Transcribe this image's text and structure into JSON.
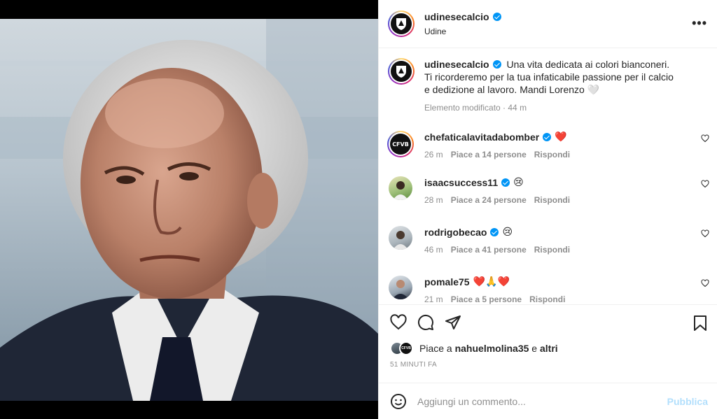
{
  "post": {
    "username": "udinesecalcio",
    "location": "Udine",
    "more_icon": "more-options-icon",
    "caption": "Una vita dedicata ai colori bianconeri. Ti ricorderemo per la tua infaticabile passione per il calcio e dedizione al lavoro. Mandi Lorenzo 🤍",
    "caption_meta": "Elemento modificato · 44 m"
  },
  "comments": [
    {
      "username": "chefaticalavitadabomber",
      "text": "❤️",
      "time": "26 m",
      "likes": "Piace a 14 persone",
      "reply": "Rispondi"
    },
    {
      "username": "isaacsuccess11",
      "text": "😢",
      "time": "28 m",
      "likes": "Piace a 24 persone",
      "reply": "Rispondi"
    },
    {
      "username": "rodrigobecao",
      "text": "😢",
      "time": "46 m",
      "likes": "Piace a 41 persone",
      "reply": "Rispondi"
    },
    {
      "username": "pomale75",
      "text": "❤️🙏❤️",
      "time": "21 m",
      "likes": "Piace a 5 persone",
      "reply": "Rispondi"
    }
  ],
  "likes": {
    "prefix": "Piace a",
    "user": "nahuelmolina35",
    "joiner": "e",
    "others": "altri"
  },
  "timestamp": "51 MINUTI FA",
  "composer": {
    "placeholder": "Aggiungi un commento...",
    "publish_label": "Pubblica"
  },
  "colors": {
    "verified": "#0095f6",
    "heart": "#ed4956",
    "publish_disabled": "#b2dffc",
    "secondary_text": "#8e8e8e"
  }
}
